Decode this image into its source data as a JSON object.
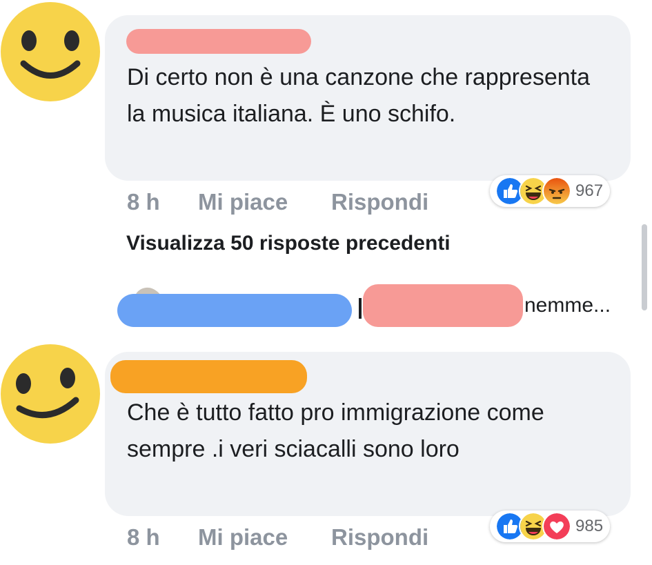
{
  "comments": [
    {
      "text": "Di certo non è una canzone che rappresenta la musica italiana. È uno schifo.",
      "time": "8 h",
      "like_label": "Mi piace",
      "reply_label": "Rispondi",
      "reaction_count": "967",
      "reactions": [
        "like-icon",
        "haha-icon",
        "angry-icon"
      ]
    },
    {
      "text": "Che è tutto fatto pro immigrazione come sempre .i veri sciacalli sono loro",
      "time": "8 h",
      "like_label": "Mi piace",
      "reply_label": "Rispondi",
      "reaction_count": "985",
      "reactions": [
        "like-icon",
        "haha-icon",
        "love-icon"
      ]
    }
  ],
  "thread": {
    "view_previous_label": "Visualizza 50 risposte precedenti",
    "reply_preview_suffix": "nemme..."
  },
  "colors": {
    "bubble": "#f0f2f5",
    "redact_pink": "#f79a96",
    "redact_blue": "#6aa2f5",
    "redact_orange": "#f8a224",
    "like_blue": "#1877f2",
    "emoji_yellow": "#f7d34a",
    "angry_red": "#e9710f",
    "love_red": "#f33e58"
  }
}
